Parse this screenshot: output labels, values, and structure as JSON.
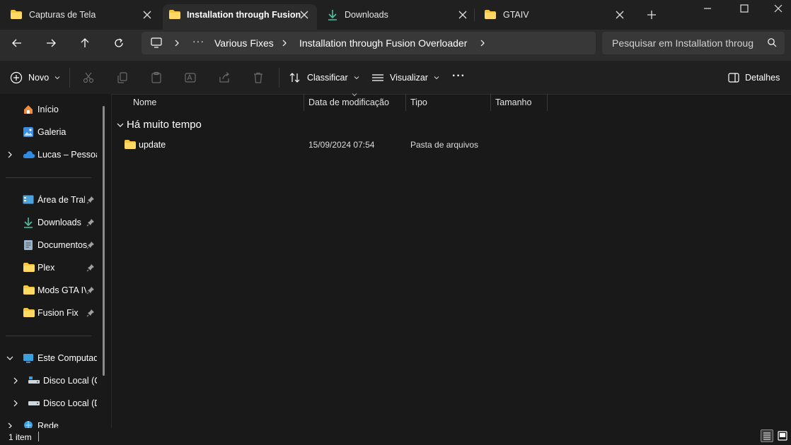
{
  "tabs": [
    {
      "label": "Capturas de Tela",
      "icon": "folder-icon"
    },
    {
      "label": "Installation through Fusion",
      "icon": "folder-icon"
    },
    {
      "label": "Downloads",
      "icon": "download-icon"
    },
    {
      "label": "GTAIV",
      "icon": "folder-icon"
    }
  ],
  "breadcrumb": {
    "overflow": "···",
    "items": [
      "Various Fixes",
      "Installation through Fusion Overloader"
    ]
  },
  "search": {
    "placeholder": "Pesquisar em Installation through"
  },
  "toolbar": {
    "new_label": "Novo",
    "sort_label": "Classificar",
    "view_label": "Visualizar",
    "more_label": "···",
    "details_label": "Detalhes"
  },
  "sidebar": {
    "top_items": [
      {
        "label": "Início",
        "icon": "home-icon"
      },
      {
        "label": "Galeria",
        "icon": "gallery-icon"
      },
      {
        "label": "Lucas – Pessoal",
        "icon": "onedrive-cloud-icon"
      }
    ],
    "pinned_items": [
      {
        "label": "Área de Trabalho",
        "icon": "desktop-icon"
      },
      {
        "label": "Downloads",
        "icon": "download-icon"
      },
      {
        "label": "Documentos",
        "icon": "document-icon"
      },
      {
        "label": "Plex",
        "icon": "folder-icon"
      },
      {
        "label": "Mods GTA IV",
        "icon": "folder-icon"
      },
      {
        "label": "Fusion Fix",
        "icon": "folder-icon"
      }
    ],
    "computer_items": [
      {
        "label": "Este Computador",
        "icon": "computer-icon"
      },
      {
        "label": "Disco Local (C:)",
        "icon": "drive-icon"
      },
      {
        "label": "Disco Local (D:)",
        "icon": "drive-icon"
      },
      {
        "label": "Rede",
        "icon": "network-icon"
      }
    ]
  },
  "columns": [
    "Nome",
    "Data de modificação",
    "Tipo",
    "Tamanho"
  ],
  "group": {
    "label": "Há muito tempo"
  },
  "files": [
    {
      "name": "update",
      "modified": "15/09/2024 07:54",
      "type": "Pasta de arquivos",
      "size": ""
    }
  ],
  "status": {
    "item_count": "1 item"
  },
  "colors": {
    "background": "#191919",
    "tab_active": "#2c2c2c",
    "folder_yellow": "#f8c73b",
    "download_green": "#4cc2a0",
    "accent_blue": "#4aa3df"
  }
}
